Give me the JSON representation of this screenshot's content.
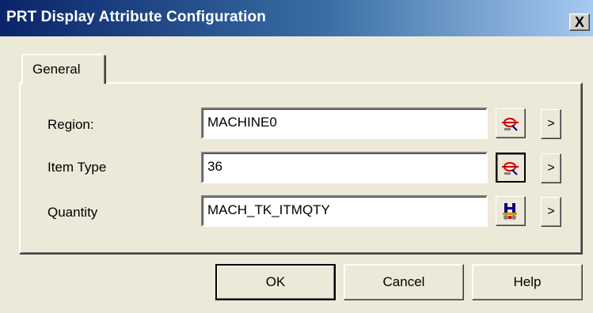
{
  "window": {
    "title": "PRT Display Attribute Configuration",
    "close_label": "X"
  },
  "tabs": [
    {
      "label": "General",
      "active": true
    }
  ],
  "fields": [
    {
      "label": "Region:",
      "value": "MACHINE0",
      "icon": "tag-search-icon"
    },
    {
      "label": "Item Type",
      "value": "36",
      "icon": "tag-search-icon"
    },
    {
      "label": "Quantity",
      "value": "MACH_TK_ITMQTY",
      "icon": "tag-browser-icon"
    }
  ],
  "arrow_label": ">",
  "buttons": {
    "ok": "OK",
    "cancel": "Cancel",
    "help": "Help"
  },
  "colors": {
    "title_gradient_start": "#0a246a",
    "title_gradient_end": "#a6caf0",
    "dialog_background": "#ece9d8",
    "icon_red": "#cc0000"
  }
}
